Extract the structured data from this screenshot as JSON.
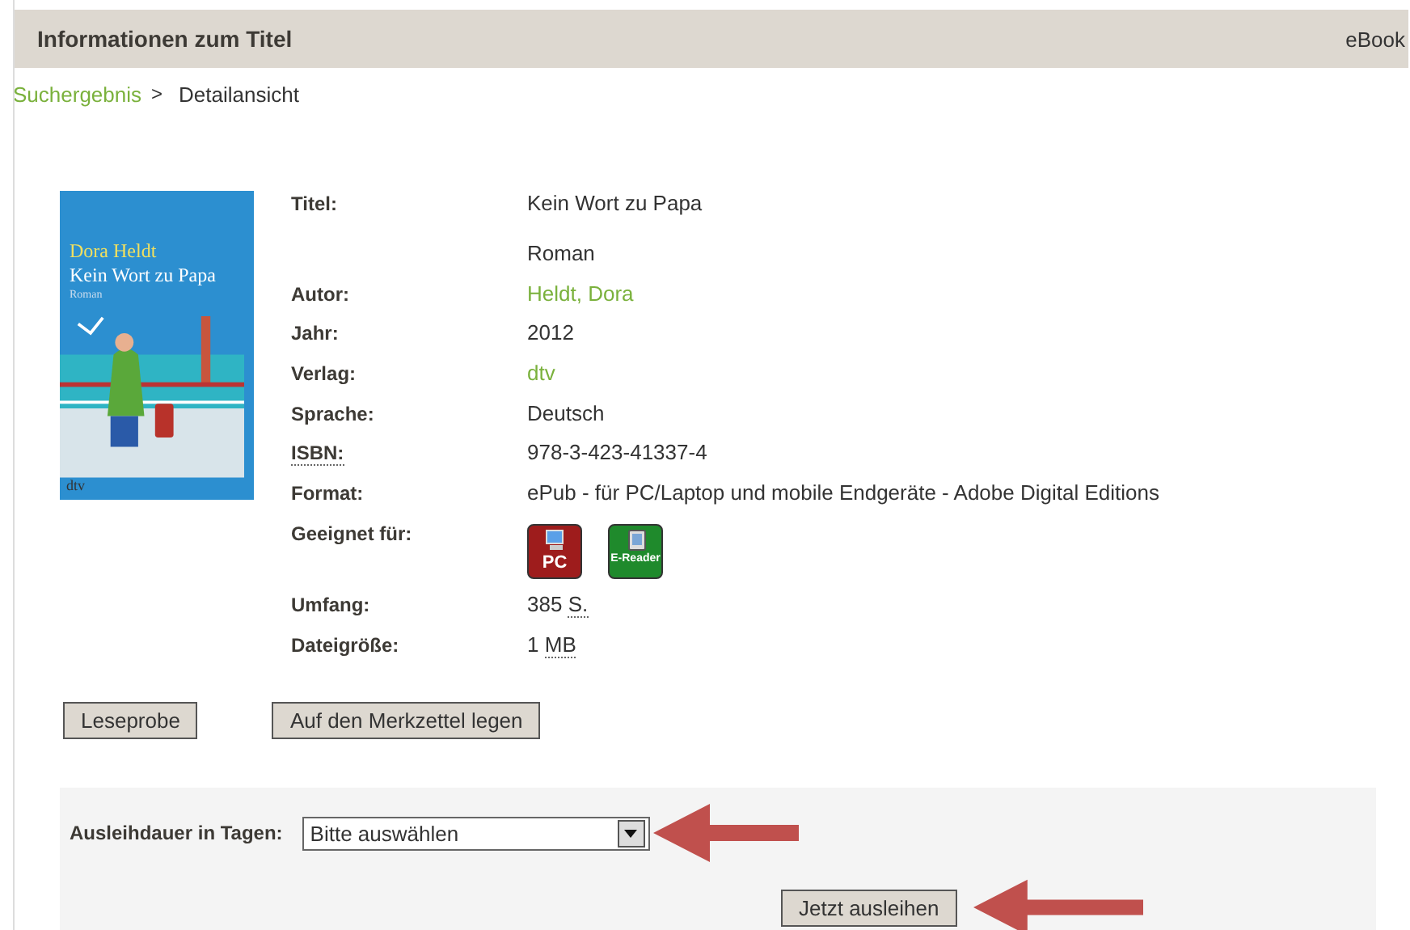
{
  "header": {
    "title": "Informationen zum Titel",
    "right_text": "eBook"
  },
  "breadcrumb": {
    "link": "Suchergebnis",
    "separator": ">",
    "current": "Detailansicht"
  },
  "cover": {
    "author": "Dora Heldt",
    "title": "Kein Wort zu Papa",
    "subtitle": "Roman",
    "publisher": "dtv"
  },
  "details": [
    {
      "kind": "text",
      "label": "Titel:",
      "value": "Kein Wort zu Papa"
    },
    {
      "kind": "text",
      "value": "Roman"
    },
    {
      "kind": "link",
      "label": "Autor:",
      "value": "Heldt, Dora"
    },
    {
      "kind": "text",
      "label": "Jahr:",
      "value": "2012"
    },
    {
      "kind": "link",
      "label": "Verlag:",
      "value": "dtv"
    },
    {
      "kind": "text",
      "label": "Sprache:",
      "value": "Deutsch"
    },
    {
      "kind": "text",
      "label": "ISBN:",
      "label_abbr": true,
      "value": "978-3-423-41337-4"
    },
    {
      "kind": "text",
      "label": "Format:",
      "value": "ePub - für PC/Laptop und mobile Endgeräte - Adobe Digital Editions"
    },
    {
      "kind": "devices",
      "label": "Geeignet für:",
      "devices": [
        {
          "label": "PC",
          "color": "#9e1c1c",
          "kind": "pc"
        },
        {
          "label": "E-Reader",
          "color": "#1f8a2c",
          "kind": "reader"
        }
      ]
    },
    {
      "kind": "abbr",
      "label": "Umfang:",
      "value": "385",
      "abbr": "S."
    },
    {
      "kind": "abbr",
      "label": "Dateigröße:",
      "value": "1",
      "abbr": "MB"
    }
  ],
  "buttons": [
    "Leseprobe",
    "Auf den Merkzettel legen"
  ],
  "loan": {
    "label": "Ausleihdauer in Tagen:",
    "select": "Bitte auswählen",
    "button": "Jetzt ausleihen"
  }
}
